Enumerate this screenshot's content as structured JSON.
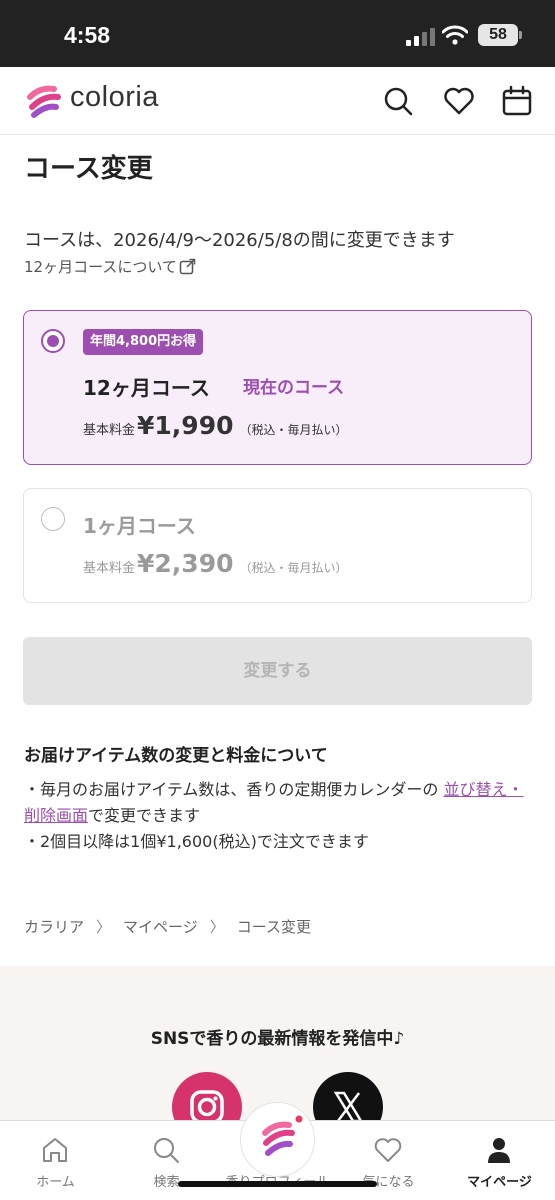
{
  "status_bar": {
    "time": "4:58",
    "battery": "58"
  },
  "header": {
    "brand": "coloria",
    "icons": [
      "search-icon",
      "heart-icon",
      "calendar-icon"
    ]
  },
  "page": {
    "title": "コース変更",
    "notice": "コースは、2026/4/9〜2026/5/8の間に変更できます",
    "about_link": "12ヶ月コースについて"
  },
  "plans": [
    {
      "badge": "年間4,800円お得",
      "name": "12ヶ月コース",
      "current_label": "現在のコース",
      "price_label": "基本料金",
      "price": "¥1,990",
      "price_note": "（税込・毎月払い）",
      "selected": true
    },
    {
      "name": "1ヶ月コース",
      "price_label": "基本料金",
      "price": "¥2,390",
      "price_note": "（税込・毎月払い）",
      "selected": false
    }
  ],
  "change_button": "変更する",
  "info": {
    "title": "お届けアイテム数の変更と料金について",
    "line1_pre": "・毎月のお届けアイテム数は、香りの定期便カレンダーの",
    "line1_link": "並び替え・削除画面",
    "line1_post": "で変更できます",
    "line2": "・2個目以降は1個¥1,600(税込)で注文できます"
  },
  "breadcrumbs": [
    "カラリア",
    "マイページ",
    "コース変更"
  ],
  "sns": {
    "title": "SNSで香りの最新情報を発信中♪",
    "icons": [
      "instagram-icon",
      "x-icon"
    ]
  },
  "tabbar": [
    {
      "label": "ホーム",
      "icon": "home-icon"
    },
    {
      "label": "検索",
      "icon": "search-icon"
    },
    {
      "label": "香りプロフィール",
      "icon": "coloria-logo-icon"
    },
    {
      "label": "気になる",
      "icon": "heart-icon"
    },
    {
      "label": "マイページ",
      "icon": "person-icon",
      "active": true
    }
  ],
  "colors": {
    "accent": "#9c4fb0",
    "accent_bg": "#f7eefa",
    "status_bar": "#222222"
  }
}
